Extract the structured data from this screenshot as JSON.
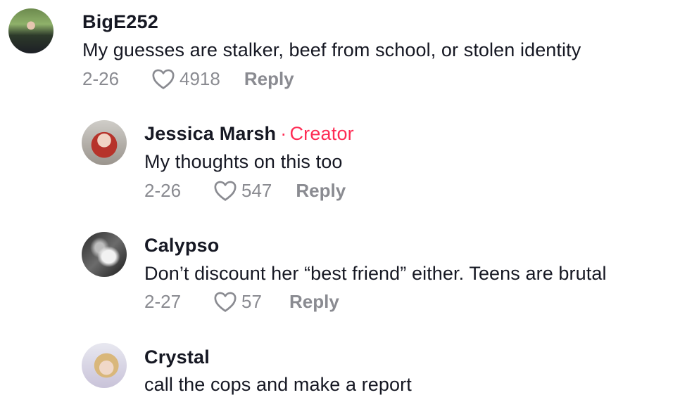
{
  "comments": [
    {
      "username": "BigE252",
      "text": "My guesses are stalker, beef from school, or stolen identity",
      "date": "2-26",
      "likes": "4918",
      "reply_label": "Reply",
      "avatar_icon": "user-avatar"
    },
    {
      "username": "Jessica Marsh",
      "creator_dot": "·",
      "creator_label": "Creator",
      "text": "My thoughts on this too",
      "date": "2-26",
      "likes": "547",
      "reply_label": "Reply",
      "avatar_icon": "user-avatar"
    },
    {
      "username": "Calypso",
      "text": "Don’t discount her “best friend” either. Teens are brutal",
      "date": "2-27",
      "likes": "57",
      "reply_label": "Reply",
      "avatar_icon": "user-avatar"
    },
    {
      "username": "Crystal",
      "text": "call the cops and make a report",
      "avatar_icon": "user-avatar"
    }
  ],
  "colors": {
    "creator": "#fe2c55",
    "meta": "#8a8b91",
    "text": "#161823"
  }
}
